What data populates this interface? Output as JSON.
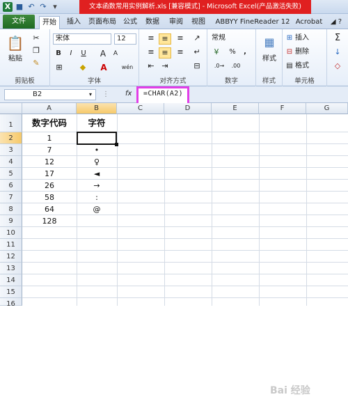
{
  "titlebar": {
    "title": "文本函数常用实例解析.xls [兼容模式] - Microsoft Excel(产品激活失败)",
    "qat": [
      "save-icon",
      "undo-icon",
      "redo-icon"
    ]
  },
  "tabs": [
    "文件",
    "开始",
    "插入",
    "页面布局",
    "公式",
    "数据",
    "审阅",
    "视图",
    "ABBYY FineReader 12",
    "Acrobat"
  ],
  "ribbon": {
    "clipboard": {
      "paste": "粘贴",
      "label": "剪贴板"
    },
    "font": {
      "name": "宋体",
      "size": "12",
      "bold": "B",
      "italic": "I",
      "underline": "U",
      "grow": "A",
      "shrink": "A",
      "fontcolor": "A",
      "wen": "wén",
      "label": "字体"
    },
    "alignment": {
      "label": "对齐方式"
    },
    "number": {
      "format": "常规",
      "percent": "%",
      "comma": ",",
      "label": "数字"
    },
    "styles": {
      "styles": "样式",
      "label": "样式"
    },
    "cells": {
      "insert": "插入",
      "delete": "删除",
      "format": "格式",
      "label": "单元格"
    }
  },
  "formula_bar": {
    "name_box": "B2",
    "fx": "fx",
    "formula": "=CHAR(A2)"
  },
  "columns": [
    "A",
    "B",
    "C",
    "D",
    "E",
    "F",
    "G"
  ],
  "rows": [
    "1",
    "2",
    "3",
    "4",
    "5",
    "6",
    "7",
    "8",
    "9",
    "10",
    "11",
    "12",
    "13",
    "14",
    "15",
    "16"
  ],
  "sheet": {
    "header_a": "数字代码",
    "header_b": "字符",
    "col_a": [
      "1",
      "7",
      "12",
      "17",
      "26",
      "58",
      "64",
      "128"
    ],
    "col_b": [
      "",
      "•",
      "♀",
      "◄",
      "→",
      ":",
      "@",
      ""
    ]
  },
  "watermark": "Bai 经验"
}
